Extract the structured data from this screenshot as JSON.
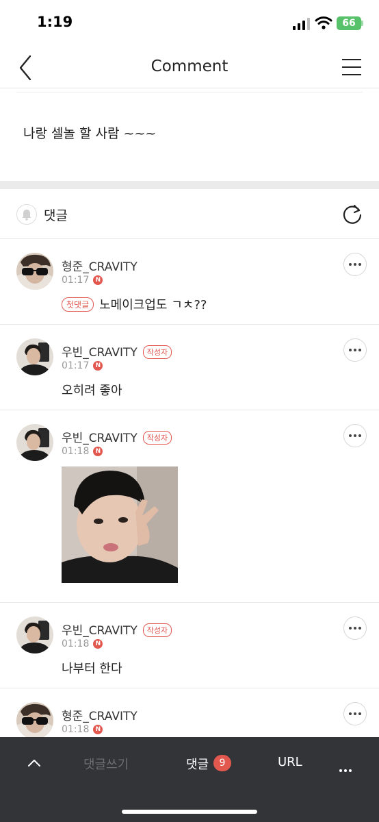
{
  "status_bar": {
    "time": "1:19",
    "battery": "66"
  },
  "header": {
    "title": "Comment"
  },
  "post": {
    "text": "나랑 셀놀 할 사람 ~~~"
  },
  "comments_section": {
    "title": "댓글"
  },
  "comments": [
    {
      "author": "형준_CRAVITY",
      "time": "01:17",
      "badge": "첫댓글",
      "text": "노메이크업도 ㄱㅊ??"
    },
    {
      "author": "우빈_CRAVITY",
      "author_badge": "작성자",
      "time": "01:17",
      "text": "오히려 좋아"
    },
    {
      "author": "우빈_CRAVITY",
      "author_badge": "작성자",
      "time": "01:18"
    },
    {
      "author": "우빈_CRAVITY",
      "author_badge": "작성자",
      "time": "01:18",
      "text": "나부터 한다"
    },
    {
      "author": "형준_CRAVITY",
      "time": "01:18"
    }
  ],
  "new_badge": "N",
  "bottom_bar": {
    "write": "댓글쓰기",
    "comments": "댓글",
    "count": "9",
    "url": "URL"
  }
}
